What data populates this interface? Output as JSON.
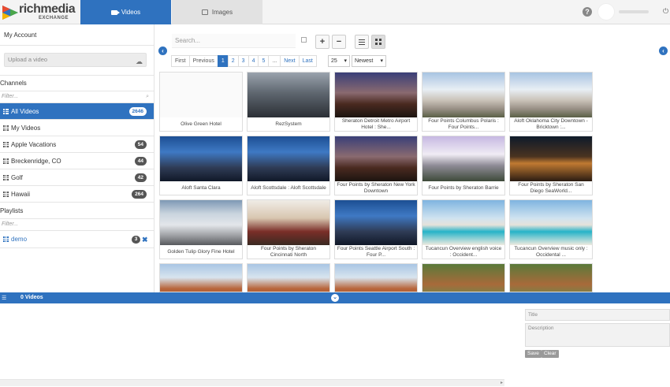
{
  "header": {
    "brand": "richmedia",
    "brand_sub": "EXCHANGE",
    "tabs": [
      {
        "label": "Videos",
        "active": true
      },
      {
        "label": "Images",
        "active": false
      }
    ],
    "help_glyph": "?",
    "power_glyph": "⏻"
  },
  "sidebar": {
    "my_account": "My Account",
    "upload_placeholder": "Upload a video",
    "channels_title": "Channels",
    "channels_filter": "Filter...",
    "channels": [
      {
        "label": "All Videos",
        "count": "2646",
        "active": true
      },
      {
        "label": "My Videos",
        "count": "",
        "active": false
      },
      {
        "label": "Apple Vacations",
        "count": "54",
        "active": false
      },
      {
        "label": "Breckenridge, CO",
        "count": "44",
        "active": false
      },
      {
        "label": "Golf",
        "count": "42",
        "active": false
      },
      {
        "label": "Hawaii",
        "count": "264",
        "active": false
      }
    ],
    "playlists_title": "Playlists",
    "playlists_filter": "Filter...",
    "playlists": [
      {
        "label": "demo",
        "count": "3"
      }
    ]
  },
  "toolbar": {
    "search_placeholder": "Search...",
    "zoom_in": "+",
    "zoom_out": "−"
  },
  "pagination": {
    "first": "First",
    "previous": "Previous",
    "pages": [
      "1",
      "2",
      "3",
      "4",
      "5"
    ],
    "ellipsis": "...",
    "next": "Next",
    "last": "Last",
    "current_page": "1",
    "per_page": "25",
    "sort": "Newest"
  },
  "videos": [
    {
      "title": "Olive Green Hotel",
      "theme": "blank"
    },
    {
      "title": "RezSystem",
      "theme": "office"
    },
    {
      "title": "Sheraton Detroit Metro Airport Hotel : She...",
      "theme": "dusk"
    },
    {
      "title": "Four Points Columbus Polaris : Four Points...",
      "theme": "day"
    },
    {
      "title": "Aloft Oklahoma City Downtown - Bricktown :...",
      "theme": "day"
    },
    {
      "title": "Aloft Santa Clara",
      "theme": "blue"
    },
    {
      "title": "Aloft Scottsdale : Aloft Scottsdale",
      "theme": "blue"
    },
    {
      "title": "Four Points by Sheraton New York Downtown",
      "theme": "dusk"
    },
    {
      "title": "Four Points by Sheraton Barrie",
      "theme": "purple"
    },
    {
      "title": "Four Points by Sheraton San Diego SeaWorld...",
      "theme": "night"
    },
    {
      "title": "Golden Tulip Glory Fine Hotel",
      "theme": "tower"
    },
    {
      "title": "Four Points by Sheraton Cincinnati North",
      "theme": "interior"
    },
    {
      "title": "Four Points Seattle Airport South : Four P...",
      "theme": "blue"
    },
    {
      "title": "Tucancun Overview english voice : Occident...",
      "theme": "beach"
    },
    {
      "title": "Tucancun Overview music only : Occidental ...",
      "theme": "beach"
    },
    {
      "title": "",
      "theme": "brick"
    },
    {
      "title": "",
      "theme": "brick"
    },
    {
      "title": "",
      "theme": "brick"
    },
    {
      "title": "",
      "theme": "resort"
    },
    {
      "title": "",
      "theme": "resort"
    }
  ],
  "bottom_panel": {
    "count_label": "0 Videos",
    "title_placeholder": "Title",
    "description_placeholder": "Description",
    "save_label": "Save",
    "clear_label": "Clear"
  },
  "colors": {
    "accent": "#2f72bf",
    "badge": "#555555"
  }
}
